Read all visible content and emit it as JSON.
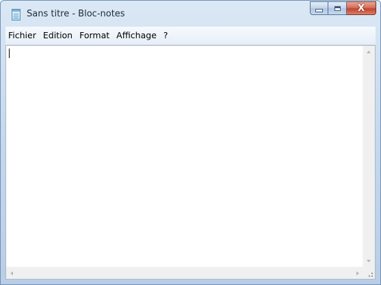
{
  "window": {
    "title": "Sans titre - Bloc-notes",
    "icon": "notepad-icon"
  },
  "caption_buttons": {
    "minimize_icon": "minimize-icon",
    "maximize_icon": "maximize-icon",
    "close_glyph": "X"
  },
  "menu": {
    "items": [
      "Fichier",
      "Edition",
      "Format",
      "Affichage",
      "?"
    ]
  },
  "editor": {
    "content": ""
  },
  "colors": {
    "close_button": "#c0452e",
    "titlebar": "#c6d9ee",
    "editor_background": "#ffffff"
  }
}
